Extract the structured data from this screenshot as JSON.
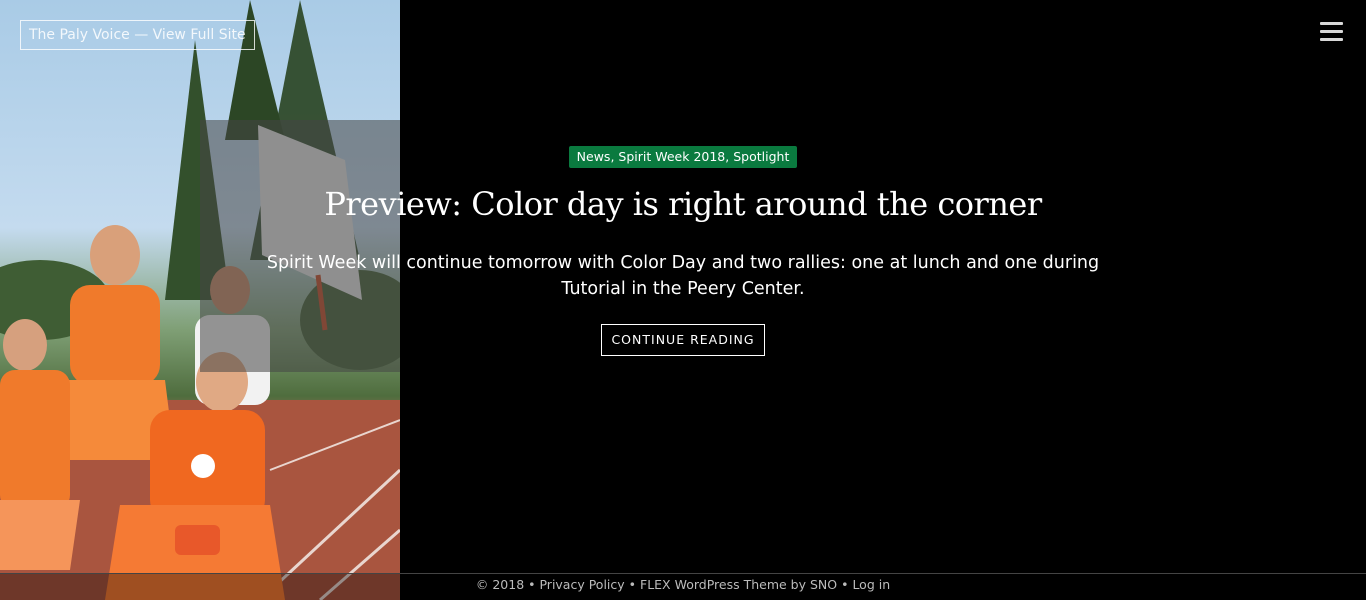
{
  "header": {
    "site_link": "The Paly Voice — View Full Site",
    "menu_icon": "hamburger-menu-icon"
  },
  "story": {
    "categories": [
      {
        "label": "News"
      },
      {
        "label": "Spirit Week 2018"
      },
      {
        "label": "Spotlight"
      }
    ],
    "category_separator": ", ",
    "title": "Preview: Color day is right around the corner",
    "excerpt": "Spirit Week will continue tomorrow with Color Day and two rallies: one at lunch and one during Tutorial in the Peery Center.",
    "cta": "CONTINUE READING",
    "category_color": "#0a7a3f"
  },
  "footer": {
    "copyright": "© 2018",
    "separator": " • ",
    "privacy": "Privacy Policy",
    "theme": "FLEX WordPress Theme by SNO",
    "login": "Log in"
  }
}
